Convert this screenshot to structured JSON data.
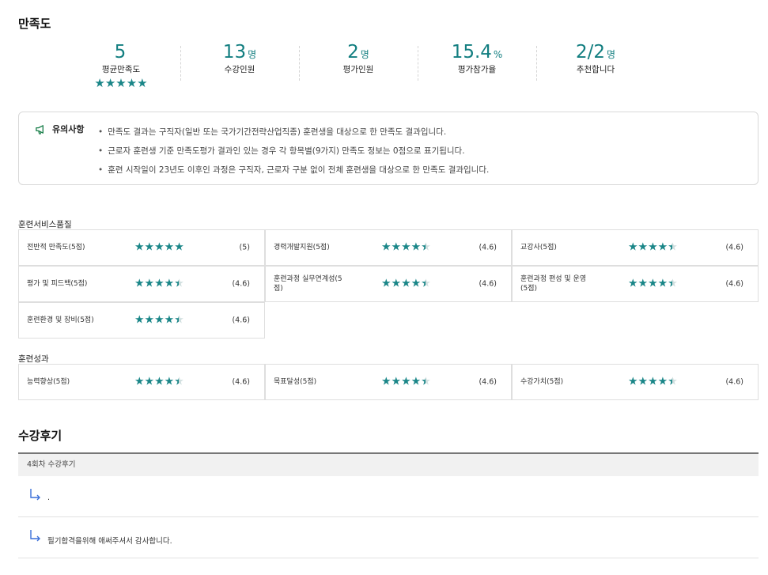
{
  "satisfaction": {
    "title": "만족도",
    "stats": [
      {
        "value": "5",
        "unit": "",
        "label": "평균만족도",
        "stars": 5
      },
      {
        "value": "13",
        "unit": "명",
        "label": "수강인원"
      },
      {
        "value": "2",
        "unit": "명",
        "label": "평가인원"
      },
      {
        "value": "15.4",
        "unit": "%",
        "label": "평가참가율"
      },
      {
        "value": "2/2",
        "unit": "명",
        "label": "추천합니다"
      }
    ]
  },
  "notice": {
    "title": "유의사항",
    "icon": "megaphone-icon",
    "items": [
      "만족도 결과는 구직자(일반 또는 국가기간전략산업직종) 훈련생을 대상으로 한 만족도 결과입니다.",
      "근로자 훈련생 기준 만족도평가 결과인 있는 경우 각 항목별(9가지) 만족도 정보는 0점으로 표기됩니다.",
      "훈련 시작일이 23년도 이후인 과정은 구직자, 근로자 구분 없이 전체 훈련생을 대상으로 한 만족도 결과입니다."
    ]
  },
  "quality": {
    "title": "훈련서비스품질",
    "items": [
      {
        "label": "전반적 만족도(5점)",
        "rating": 5,
        "score": "(5)"
      },
      {
        "label": "경력개발지원(5점)",
        "rating": 4.6,
        "score": "(4.6)"
      },
      {
        "label": "교강사(5점)",
        "rating": 4.6,
        "score": "(4.6)"
      },
      {
        "label": "평가 및 피드백(5점)",
        "rating": 4.6,
        "score": "(4.6)"
      },
      {
        "label": "훈련과정 실무연계성(5점)",
        "rating": 4.6,
        "score": "(4.6)"
      },
      {
        "label": "훈련과정 편성 및 운영(5점)",
        "rating": 4.6,
        "score": "(4.6)"
      },
      {
        "label": "훈련환경 및 장비(5점)",
        "rating": 4.6,
        "score": "(4.6)"
      }
    ]
  },
  "outcome": {
    "title": "훈련성과",
    "items": [
      {
        "label": "능력향상(5점)",
        "rating": 4.6,
        "score": "(4.6)"
      },
      {
        "label": "목표달성(5점)",
        "rating": 4.6,
        "score": "(4.6)"
      },
      {
        "label": "수강가치(5점)",
        "rating": 4.6,
        "score": "(4.6)"
      }
    ]
  },
  "reviews": {
    "title": "수강후기",
    "session_header": "4회차 수강후기",
    "items": [
      {
        "text": "."
      },
      {
        "text": "필기합격을위해 애써주셔서 감사합니다."
      }
    ]
  },
  "colors": {
    "accent": "#127e80",
    "star": "#1a8688"
  }
}
